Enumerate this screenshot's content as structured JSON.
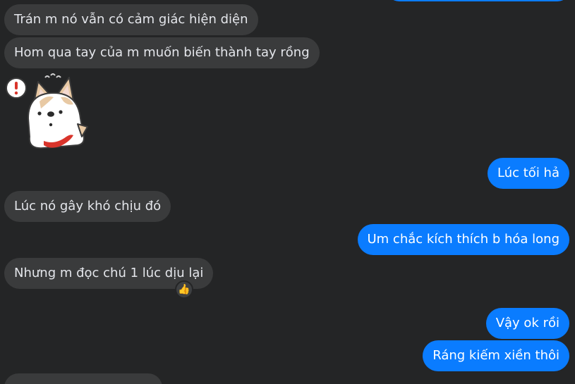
{
  "conversation": {
    "messages": [
      {
        "direction": "incoming",
        "text": "Trán m nó vẫn có cảm giác hiện diện"
      },
      {
        "direction": "incoming",
        "text": "Hom qua tay của m muốn biến thành tay rồng"
      },
      {
        "direction": "incoming",
        "sticker": "shiba-dog-exclamation-sticker"
      },
      {
        "direction": "outgoing",
        "text": "Lúc tối hả"
      },
      {
        "direction": "incoming",
        "text": "Lúc nó gây khó chịu đó"
      },
      {
        "direction": "outgoing",
        "text": "Um chắc kích thích b hóa long"
      },
      {
        "direction": "incoming",
        "text": "Nhưng m đọc chú 1 lúc dịu lại",
        "reaction": "thumbs-up-icon"
      },
      {
        "direction": "outgoing",
        "text": "Vậy ok rồi"
      },
      {
        "direction": "outgoing",
        "text": "Ráng kiếm xiền thôi"
      }
    ]
  },
  "colors": {
    "background": "#242526",
    "incoming_bubble": "#3a3b3c",
    "outgoing_bubble": "#0a7cff",
    "incoming_text": "#e4e6eb",
    "outgoing_text": "#ffffff"
  }
}
